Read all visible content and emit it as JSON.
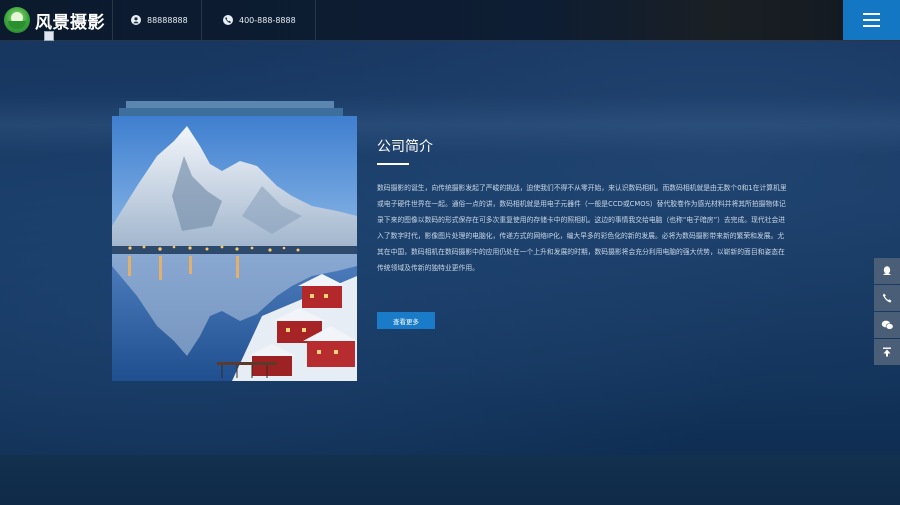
{
  "header": {
    "brand_name": "风景摄影",
    "contacts": [
      {
        "icon": "user-icon",
        "text": "88888888"
      },
      {
        "icon": "phone-icon",
        "text": "400-888-8888"
      }
    ],
    "menu_icon": "hamburger-menu-icon"
  },
  "intro": {
    "title": "公司简介",
    "body": "数码摄影的诞生，向传统摄影发起了严峻的挑战，迫使我们不得不从零开始，来认识数码相机。而数码相机就是由无数个0和1在计算机里或电子硬件世界在一起。通俗一点的讲，数码相机就是用电子元器件（一般是CCD或CMOS）替代胶卷作为感光材料并将其所拍摄物体记录下来的图像以数码的形式保存在可多次重复使用的存储卡中的照相机。这边的事情我交给电脑（也称“电子暗房”）去完成。现代社会进入了数字时代，影像图片处理的电脑化，传递方式的网络IP化，编大早多的彩色化的新的发展。必将为数码摄影带来新的繁荣和发展。尤其在中国，数码相机在数码摄影中的应用仍处在一个上升和发展的时期，数码摄影将会充分利用电脑的强大优势，以崭新的面目和姿态在传统领域及传新的独特业更作用。",
    "more_button": "查看更多"
  },
  "side_tools": [
    {
      "icon": "qq-icon"
    },
    {
      "icon": "phone-icon"
    },
    {
      "icon": "wechat-icon"
    },
    {
      "icon": "back-to-top-icon"
    }
  ],
  "colors": {
    "accent": "#1a7cc9",
    "menu_bg": "#1477c4",
    "page_bg": "#173a64",
    "side_btn": "#4a5f77"
  }
}
